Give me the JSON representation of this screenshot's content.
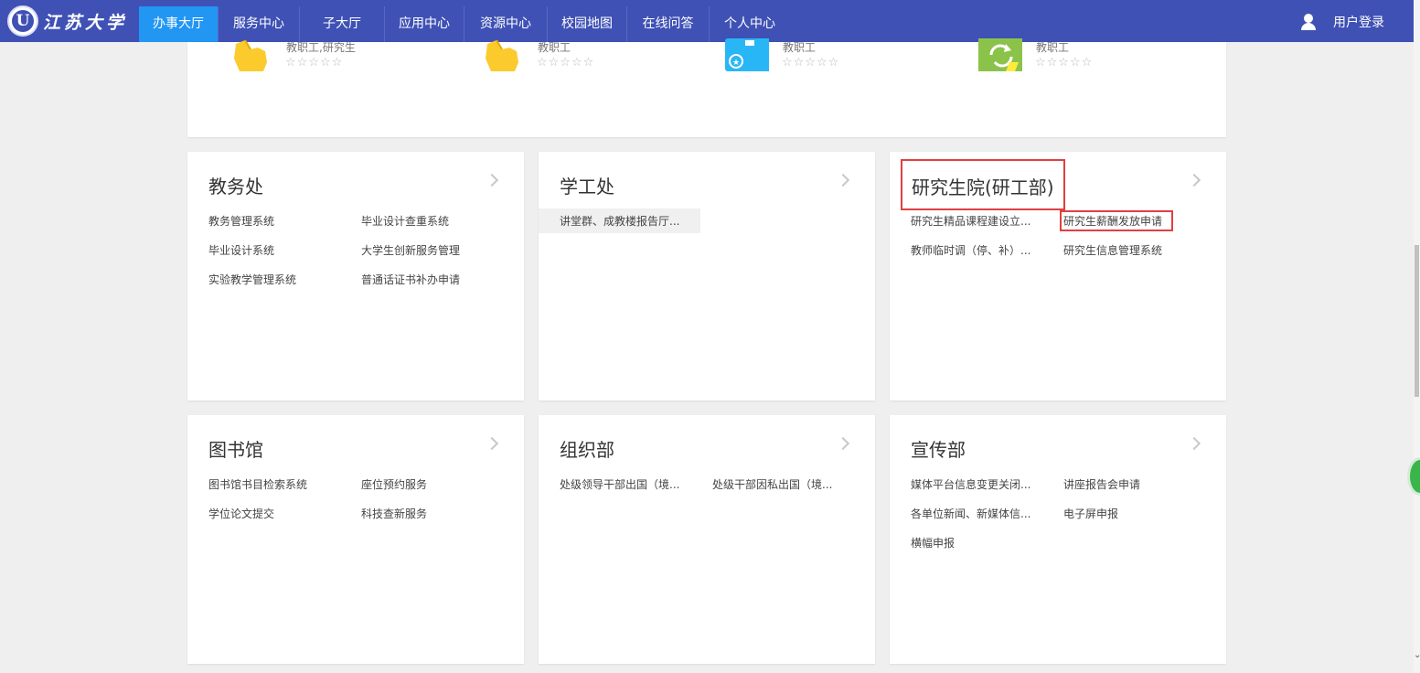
{
  "brand": {
    "name": "江苏大学",
    "seal_letter": "U"
  },
  "nav": {
    "items": [
      {
        "label": "办事大厅",
        "active": true
      },
      {
        "label": "服务中心",
        "active": false
      },
      {
        "label": "子大厅",
        "active": false
      },
      {
        "label": "应用中心",
        "active": false
      },
      {
        "label": "资源中心",
        "active": false
      },
      {
        "label": "校园地图",
        "active": false
      },
      {
        "label": "在线问答",
        "active": false
      },
      {
        "label": "个人中心",
        "active": false
      }
    ],
    "login_label": "用户登录",
    "login_icon": "user-icon"
  },
  "featured": {
    "items": [
      {
        "tag": "教职工,研究生",
        "stars": "☆☆☆☆☆",
        "icon": "hand-pointer-icon"
      },
      {
        "tag": "教职工",
        "stars": "☆☆☆☆☆",
        "icon": "hand-pointer-icon"
      },
      {
        "tag": "教职工",
        "stars": "☆☆☆☆☆",
        "icon": "id-card-icon"
      },
      {
        "tag": "教职工",
        "stars": "☆☆☆☆☆",
        "icon": "refresh-icon"
      }
    ]
  },
  "departments": [
    {
      "title": "教务处",
      "links": [
        "教务管理系统",
        "毕业设计查重系统",
        "毕业设计系统",
        "大学生创新服务管理",
        "实验教学管理系统",
        "普通话证书补办申请"
      ]
    },
    {
      "title": "学工处",
      "links": [
        "讲堂群、成教楼报告厅..."
      ]
    },
    {
      "title": "研究生院(研工部)",
      "links": [
        "研究生精品课程建设立...",
        "研究生薪酬发放申请",
        "教师临时调（停、补）...",
        "研究生信息管理系统"
      ]
    },
    {
      "title": "图书馆",
      "links": [
        "图书馆书目检索系统",
        "座位预约服务",
        "学位论文提交",
        "科技查新服务"
      ]
    },
    {
      "title": "组织部",
      "links": [
        "处级领导干部出国（境...",
        "处级干部因私出国（境..."
      ]
    },
    {
      "title": "宣传部",
      "links": [
        "媒体平台信息变更关闭...",
        "讲座报告会申请",
        "各单位新闻、新媒体信...",
        "电子屏申报",
        "横幅申报"
      ]
    }
  ],
  "colors": {
    "navbar": "#3f51b5",
    "active_tab": "#2196f3",
    "highlight_border": "#e04040"
  }
}
